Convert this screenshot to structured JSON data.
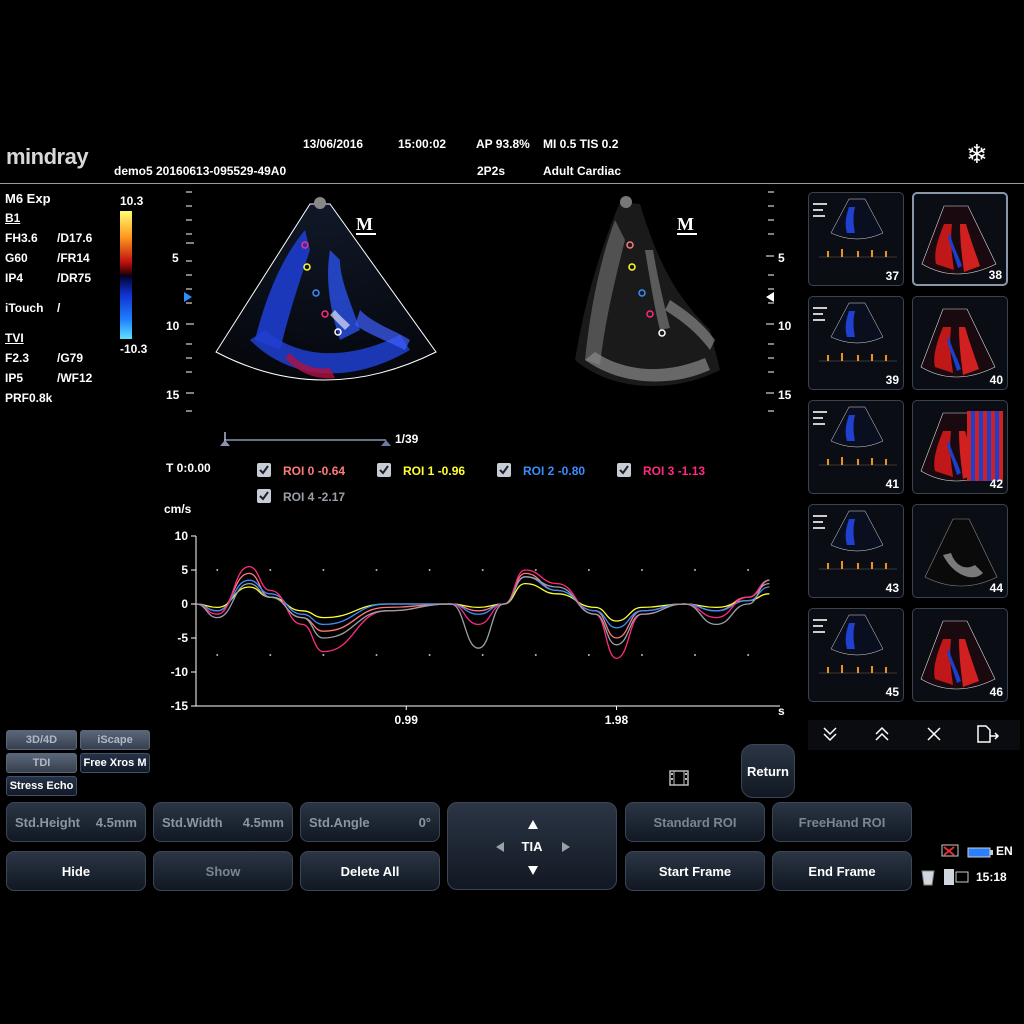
{
  "header": {
    "brand": "mindray",
    "patient": "demo5 20160613-095529-49A0",
    "date": "13/06/2016",
    "time": "15:00:02",
    "ap": "AP 93.8%",
    "mi_tis": "MI 0.5 TIS 0.2",
    "probe": "2P2s",
    "exam": "Adult Cardiac"
  },
  "params": {
    "mode": "M6 Exp",
    "b1": "B1",
    "fh": "FH3.6",
    "d": "/D17.6",
    "g": "G60",
    "fr": "/FR14",
    "ip": "IP4",
    "dr": "/DR75",
    "itouch": "iTouch",
    "itouch_sep": "/",
    "tvi": "TVI",
    "f": "F2.3",
    "g2": "/G79",
    "ip2": "IP5",
    "wf": "/WF12",
    "prf": "PRF0.8k"
  },
  "colorbar": {
    "max": "10.3",
    "min": "-10.3"
  },
  "depth_ticks": [
    "5",
    "10",
    "15"
  ],
  "cine": {
    "counter": "1/39",
    "time": "T 0:0.00"
  },
  "rois": [
    {
      "label": "ROI 0",
      "value": "-0.64",
      "color": "#ff7a7a"
    },
    {
      "label": "ROI 1",
      "value": "-0.96",
      "color": "#ffff33"
    },
    {
      "label": "ROI 2",
      "value": "-0.80",
      "color": "#3a8dff"
    },
    {
      "label": "ROI 3",
      "value": "-1.13",
      "color": "#ff2a80"
    },
    {
      "label": "ROI 4",
      "value": "-2.17",
      "color": "#9aa0a8"
    }
  ],
  "chart_data": {
    "type": "line",
    "ylabel": "cm/s",
    "xlabel": "s",
    "ylim": [
      -15,
      10
    ],
    "yticks": [
      "10",
      "5",
      "0",
      "-5",
      "-10",
      "-15"
    ],
    "xticks": [
      "0.99",
      "1.98"
    ],
    "series": [
      {
        "name": "ROI 0",
        "color": "#ff7a7a",
        "x": [
          0,
          0.1,
          0.25,
          0.35,
          0.5,
          0.6,
          0.9,
          1.2,
          1.33,
          1.45,
          1.55,
          1.7,
          1.88,
          1.98,
          2.1,
          2.3,
          2.45,
          2.6,
          2.7
        ],
        "values": [
          0,
          -1,
          4.5,
          1,
          -2,
          -4,
          -0.5,
          0,
          -1,
          0,
          4.5,
          2,
          -1,
          -5,
          -1,
          0,
          -1,
          1,
          3
        ]
      },
      {
        "name": "ROI 1",
        "color": "#ffff33",
        "x": [
          0,
          0.1,
          0.25,
          0.35,
          0.5,
          0.6,
          0.9,
          1.2,
          1.33,
          1.45,
          1.55,
          1.7,
          1.88,
          1.98,
          2.1,
          2.3,
          2.45,
          2.6,
          2.7
        ],
        "values": [
          0,
          -0.5,
          2.5,
          1,
          -1,
          -2,
          0,
          0,
          -0.5,
          0,
          3,
          1.5,
          -0.5,
          -2.5,
          -0.5,
          0,
          -0.5,
          0.5,
          1.5
        ]
      },
      {
        "name": "ROI 2",
        "color": "#3a8dff",
        "x": [
          0,
          0.1,
          0.25,
          0.35,
          0.5,
          0.6,
          0.9,
          1.2,
          1.33,
          1.45,
          1.55,
          1.7,
          1.88,
          1.98,
          2.1,
          2.3,
          2.45,
          2.6,
          2.7
        ],
        "values": [
          0,
          -1,
          3.5,
          1.5,
          -1.5,
          -3,
          0,
          0,
          -1.5,
          0,
          4,
          2,
          -1,
          -3.5,
          -1,
          0,
          -1,
          0.5,
          2.5
        ]
      },
      {
        "name": "ROI 3",
        "color": "#ff2a80",
        "x": [
          0,
          0.1,
          0.25,
          0.35,
          0.5,
          0.6,
          0.9,
          1.2,
          1.33,
          1.45,
          1.55,
          1.7,
          1.88,
          1.98,
          2.1,
          2.3,
          2.45,
          2.6,
          2.7
        ],
        "values": [
          0,
          -1.5,
          5.5,
          2,
          -3,
          -7,
          -1,
          0,
          -3,
          0,
          5,
          3,
          -1.5,
          -8,
          -1.5,
          0,
          -2,
          1,
          3.5
        ]
      },
      {
        "name": "ROI 4",
        "color": "#9aa0a8",
        "x": [
          0,
          0.1,
          0.25,
          0.35,
          0.5,
          0.6,
          0.9,
          1.2,
          1.33,
          1.45,
          1.55,
          1.7,
          1.88,
          1.98,
          2.1,
          2.3,
          2.45,
          2.6,
          2.7
        ],
        "values": [
          0,
          -2,
          3,
          1,
          -2,
          -5,
          -1,
          0,
          -6.5,
          0,
          4,
          2.5,
          -1.5,
          -6,
          -1.5,
          0,
          -3,
          0,
          3.5
        ]
      }
    ]
  },
  "thumbnails": [
    "37",
    "38",
    "39",
    "40",
    "41",
    "42",
    "43",
    "44",
    "45",
    "46"
  ],
  "tia": "TIA",
  "buttons": {
    "b3d4d": "3D/4D",
    "iscape": "iScape",
    "tdi": "TDI",
    "freexros": "Free Xros M",
    "stress": "Stress Echo",
    "return": "Return",
    "std_height": "Std.Height",
    "std_height_val": "4.5mm",
    "std_width": "Std.Width",
    "std_width_val": "4.5mm",
    "std_angle": "Std.Angle",
    "std_angle_val": "0°",
    "standard_roi": "Standard ROI",
    "freehand_roi": "FreeHand ROI",
    "hide": "Hide",
    "show": "Show",
    "delete_all": "Delete All",
    "start_frame": "Start Frame",
    "end_frame": "End Frame"
  },
  "tray": {
    "lang": "EN",
    "clock": "15:18"
  }
}
